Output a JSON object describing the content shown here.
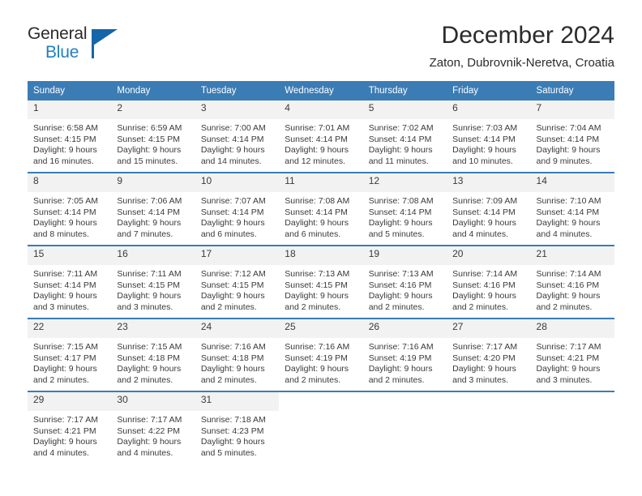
{
  "brand": {
    "name_part1": "General",
    "name_part2": "Blue",
    "triangle_color": "#1565a8",
    "blue_color": "#1f7fc4"
  },
  "header": {
    "title": "December 2024",
    "subtitle": "Zaton, Dubrovnik-Neretva, Croatia",
    "header_bg": "#3b7cb5",
    "daynum_bg": "#f2f2f2"
  },
  "weekdays": [
    "Sunday",
    "Monday",
    "Tuesday",
    "Wednesday",
    "Thursday",
    "Friday",
    "Saturday"
  ],
  "weeks": [
    [
      {
        "day": "1",
        "sunrise": "Sunrise: 6:58 AM",
        "sunset": "Sunset: 4:15 PM",
        "daylight1": "Daylight: 9 hours",
        "daylight2": "and 16 minutes."
      },
      {
        "day": "2",
        "sunrise": "Sunrise: 6:59 AM",
        "sunset": "Sunset: 4:15 PM",
        "daylight1": "Daylight: 9 hours",
        "daylight2": "and 15 minutes."
      },
      {
        "day": "3",
        "sunrise": "Sunrise: 7:00 AM",
        "sunset": "Sunset: 4:14 PM",
        "daylight1": "Daylight: 9 hours",
        "daylight2": "and 14 minutes."
      },
      {
        "day": "4",
        "sunrise": "Sunrise: 7:01 AM",
        "sunset": "Sunset: 4:14 PM",
        "daylight1": "Daylight: 9 hours",
        "daylight2": "and 12 minutes."
      },
      {
        "day": "5",
        "sunrise": "Sunrise: 7:02 AM",
        "sunset": "Sunset: 4:14 PM",
        "daylight1": "Daylight: 9 hours",
        "daylight2": "and 11 minutes."
      },
      {
        "day": "6",
        "sunrise": "Sunrise: 7:03 AM",
        "sunset": "Sunset: 4:14 PM",
        "daylight1": "Daylight: 9 hours",
        "daylight2": "and 10 minutes."
      },
      {
        "day": "7",
        "sunrise": "Sunrise: 7:04 AM",
        "sunset": "Sunset: 4:14 PM",
        "daylight1": "Daylight: 9 hours",
        "daylight2": "and 9 minutes."
      }
    ],
    [
      {
        "day": "8",
        "sunrise": "Sunrise: 7:05 AM",
        "sunset": "Sunset: 4:14 PM",
        "daylight1": "Daylight: 9 hours",
        "daylight2": "and 8 minutes."
      },
      {
        "day": "9",
        "sunrise": "Sunrise: 7:06 AM",
        "sunset": "Sunset: 4:14 PM",
        "daylight1": "Daylight: 9 hours",
        "daylight2": "and 7 minutes."
      },
      {
        "day": "10",
        "sunrise": "Sunrise: 7:07 AM",
        "sunset": "Sunset: 4:14 PM",
        "daylight1": "Daylight: 9 hours",
        "daylight2": "and 6 minutes."
      },
      {
        "day": "11",
        "sunrise": "Sunrise: 7:08 AM",
        "sunset": "Sunset: 4:14 PM",
        "daylight1": "Daylight: 9 hours",
        "daylight2": "and 6 minutes."
      },
      {
        "day": "12",
        "sunrise": "Sunrise: 7:08 AM",
        "sunset": "Sunset: 4:14 PM",
        "daylight1": "Daylight: 9 hours",
        "daylight2": "and 5 minutes."
      },
      {
        "day": "13",
        "sunrise": "Sunrise: 7:09 AM",
        "sunset": "Sunset: 4:14 PM",
        "daylight1": "Daylight: 9 hours",
        "daylight2": "and 4 minutes."
      },
      {
        "day": "14",
        "sunrise": "Sunrise: 7:10 AM",
        "sunset": "Sunset: 4:14 PM",
        "daylight1": "Daylight: 9 hours",
        "daylight2": "and 4 minutes."
      }
    ],
    [
      {
        "day": "15",
        "sunrise": "Sunrise: 7:11 AM",
        "sunset": "Sunset: 4:14 PM",
        "daylight1": "Daylight: 9 hours",
        "daylight2": "and 3 minutes."
      },
      {
        "day": "16",
        "sunrise": "Sunrise: 7:11 AM",
        "sunset": "Sunset: 4:15 PM",
        "daylight1": "Daylight: 9 hours",
        "daylight2": "and 3 minutes."
      },
      {
        "day": "17",
        "sunrise": "Sunrise: 7:12 AM",
        "sunset": "Sunset: 4:15 PM",
        "daylight1": "Daylight: 9 hours",
        "daylight2": "and 2 minutes."
      },
      {
        "day": "18",
        "sunrise": "Sunrise: 7:13 AM",
        "sunset": "Sunset: 4:15 PM",
        "daylight1": "Daylight: 9 hours",
        "daylight2": "and 2 minutes."
      },
      {
        "day": "19",
        "sunrise": "Sunrise: 7:13 AM",
        "sunset": "Sunset: 4:16 PM",
        "daylight1": "Daylight: 9 hours",
        "daylight2": "and 2 minutes."
      },
      {
        "day": "20",
        "sunrise": "Sunrise: 7:14 AM",
        "sunset": "Sunset: 4:16 PM",
        "daylight1": "Daylight: 9 hours",
        "daylight2": "and 2 minutes."
      },
      {
        "day": "21",
        "sunrise": "Sunrise: 7:14 AM",
        "sunset": "Sunset: 4:16 PM",
        "daylight1": "Daylight: 9 hours",
        "daylight2": "and 2 minutes."
      }
    ],
    [
      {
        "day": "22",
        "sunrise": "Sunrise: 7:15 AM",
        "sunset": "Sunset: 4:17 PM",
        "daylight1": "Daylight: 9 hours",
        "daylight2": "and 2 minutes."
      },
      {
        "day": "23",
        "sunrise": "Sunrise: 7:15 AM",
        "sunset": "Sunset: 4:18 PM",
        "daylight1": "Daylight: 9 hours",
        "daylight2": "and 2 minutes."
      },
      {
        "day": "24",
        "sunrise": "Sunrise: 7:16 AM",
        "sunset": "Sunset: 4:18 PM",
        "daylight1": "Daylight: 9 hours",
        "daylight2": "and 2 minutes."
      },
      {
        "day": "25",
        "sunrise": "Sunrise: 7:16 AM",
        "sunset": "Sunset: 4:19 PM",
        "daylight1": "Daylight: 9 hours",
        "daylight2": "and 2 minutes."
      },
      {
        "day": "26",
        "sunrise": "Sunrise: 7:16 AM",
        "sunset": "Sunset: 4:19 PM",
        "daylight1": "Daylight: 9 hours",
        "daylight2": "and 2 minutes."
      },
      {
        "day": "27",
        "sunrise": "Sunrise: 7:17 AM",
        "sunset": "Sunset: 4:20 PM",
        "daylight1": "Daylight: 9 hours",
        "daylight2": "and 3 minutes."
      },
      {
        "day": "28",
        "sunrise": "Sunrise: 7:17 AM",
        "sunset": "Sunset: 4:21 PM",
        "daylight1": "Daylight: 9 hours",
        "daylight2": "and 3 minutes."
      }
    ],
    [
      {
        "day": "29",
        "sunrise": "Sunrise: 7:17 AM",
        "sunset": "Sunset: 4:21 PM",
        "daylight1": "Daylight: 9 hours",
        "daylight2": "and 4 minutes."
      },
      {
        "day": "30",
        "sunrise": "Sunrise: 7:17 AM",
        "sunset": "Sunset: 4:22 PM",
        "daylight1": "Daylight: 9 hours",
        "daylight2": "and 4 minutes."
      },
      {
        "day": "31",
        "sunrise": "Sunrise: 7:18 AM",
        "sunset": "Sunset: 4:23 PM",
        "daylight1": "Daylight: 9 hours",
        "daylight2": "and 5 minutes."
      },
      {
        "day": "",
        "sunrise": "",
        "sunset": "",
        "daylight1": "",
        "daylight2": ""
      },
      {
        "day": "",
        "sunrise": "",
        "sunset": "",
        "daylight1": "",
        "daylight2": ""
      },
      {
        "day": "",
        "sunrise": "",
        "sunset": "",
        "daylight1": "",
        "daylight2": ""
      },
      {
        "day": "",
        "sunrise": "",
        "sunset": "",
        "daylight1": "",
        "daylight2": ""
      }
    ]
  ]
}
